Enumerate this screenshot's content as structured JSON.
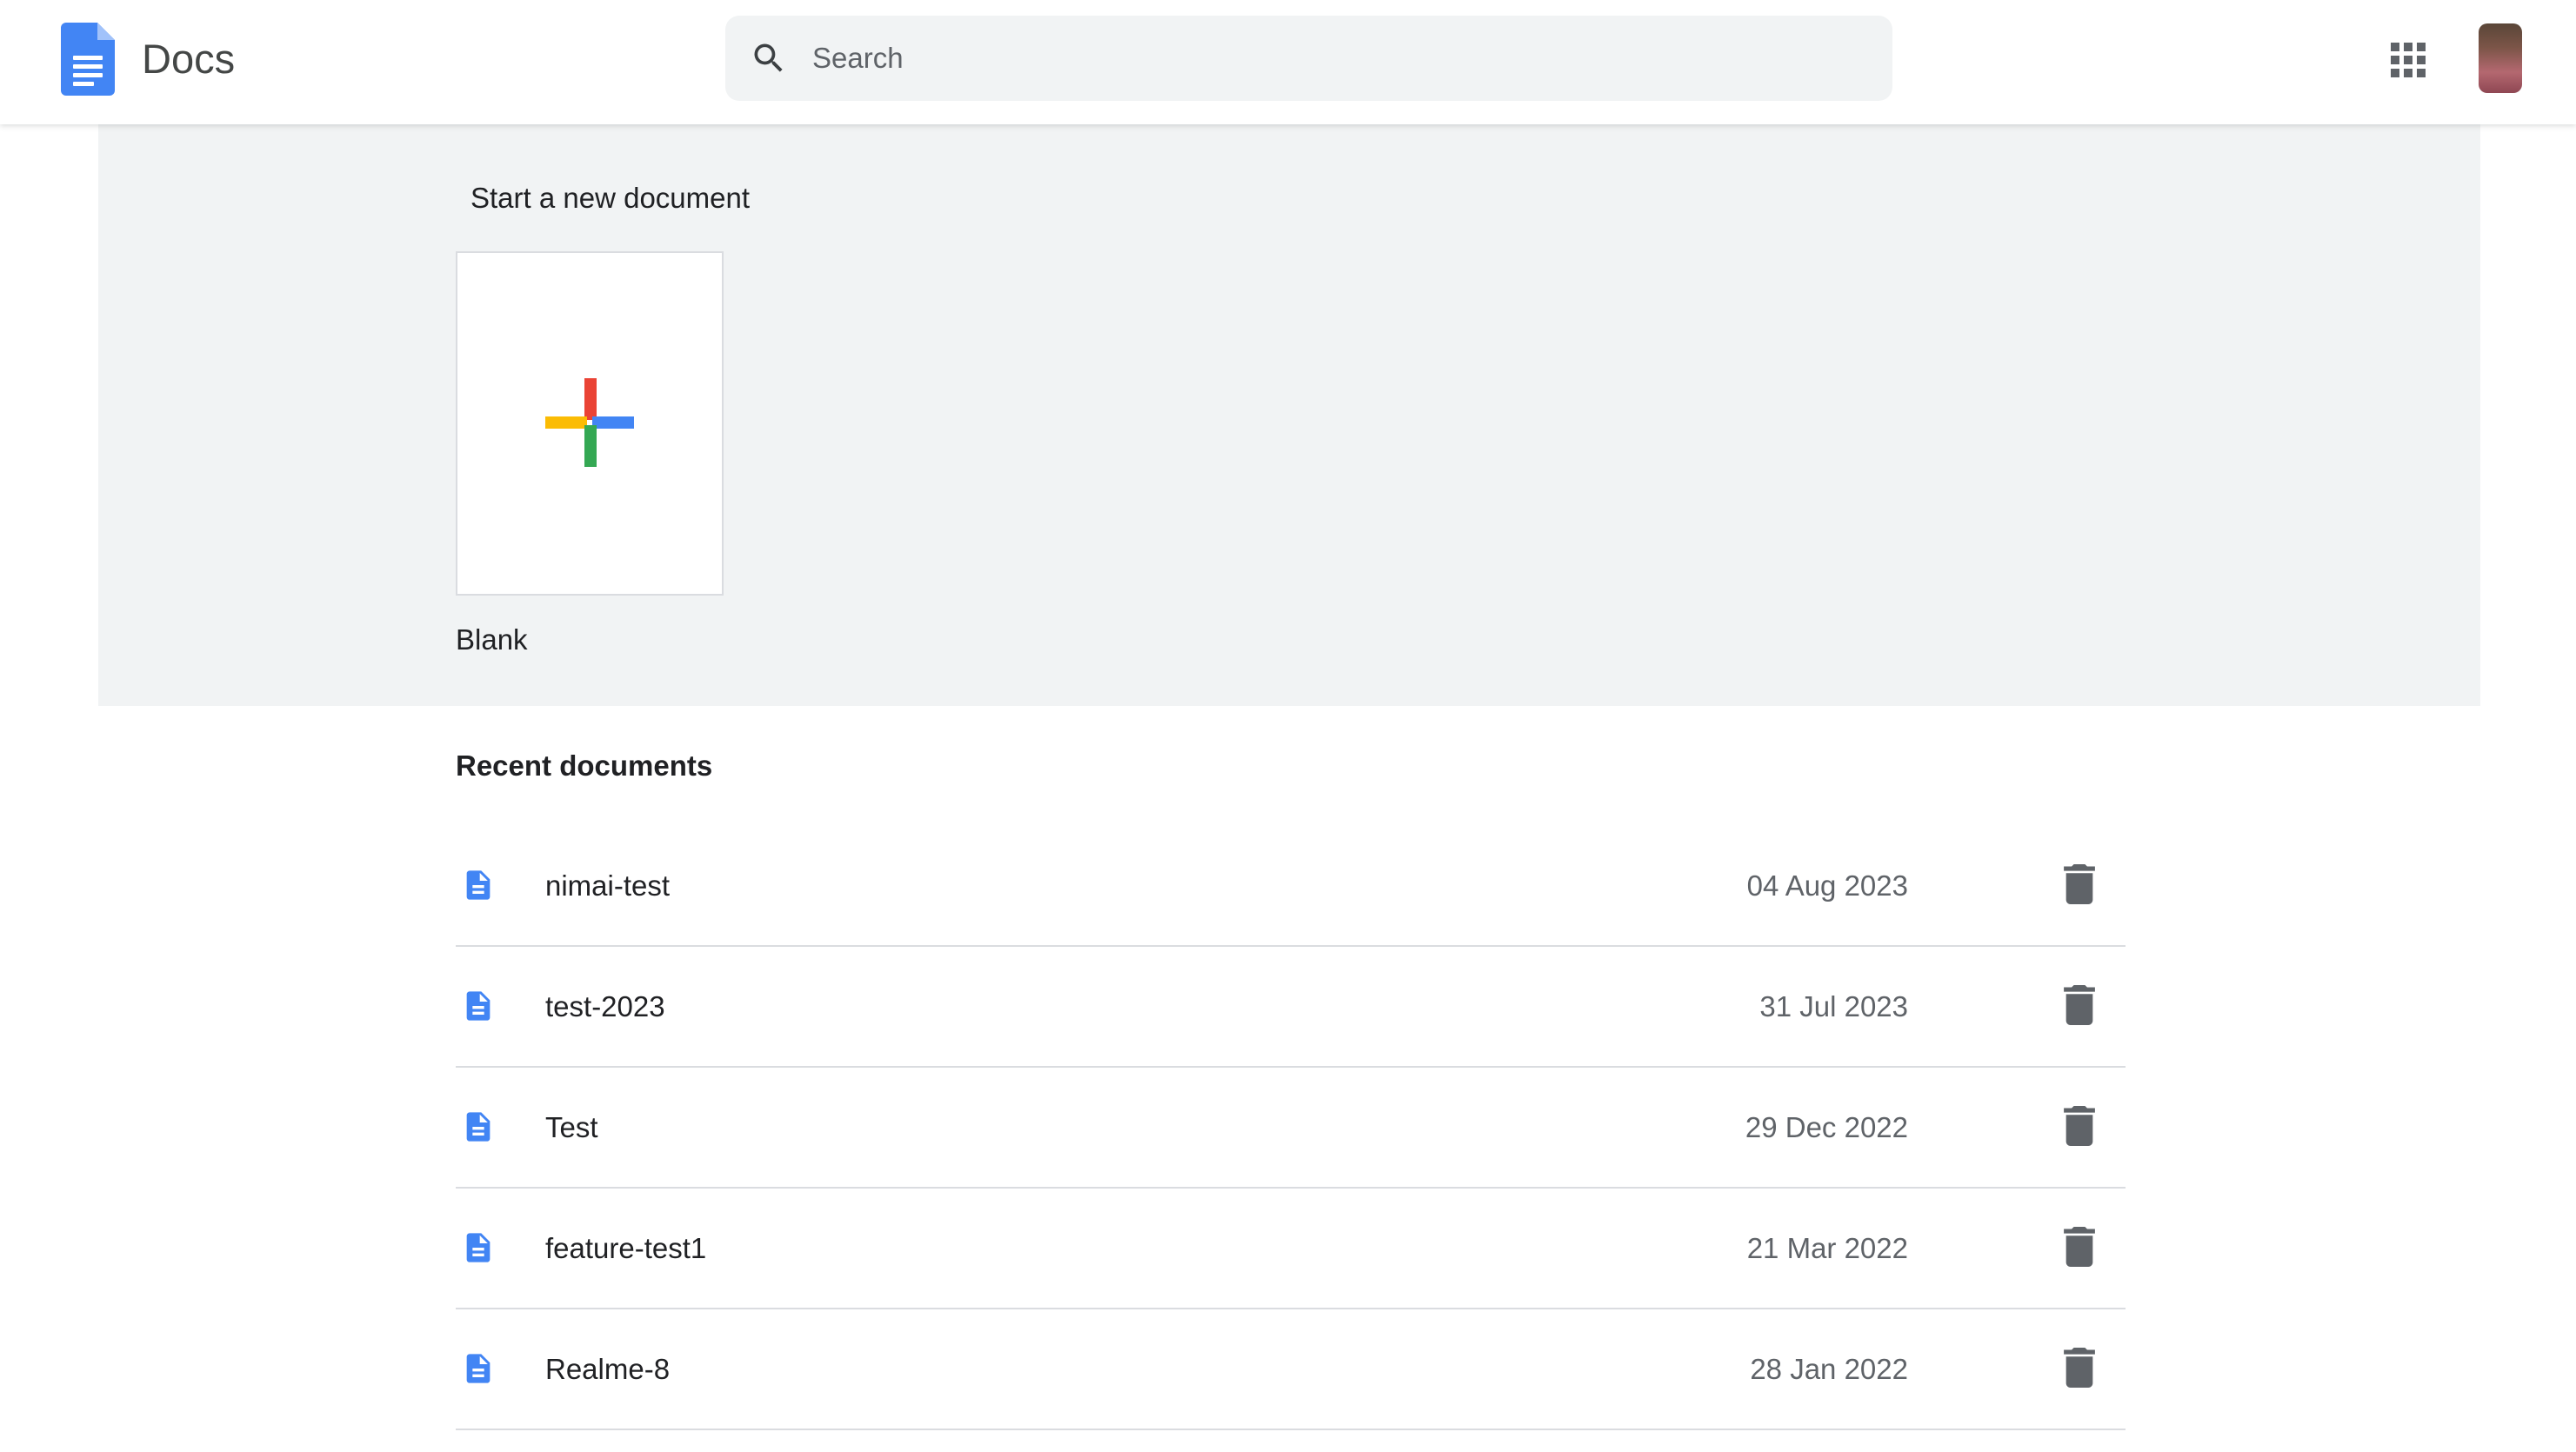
{
  "header": {
    "app_title": "Docs",
    "search_placeholder": "Search",
    "search_value": "",
    "apps_icon": "apps-grid-icon",
    "avatar": "user-avatar"
  },
  "new_document": {
    "heading": "Start a new document",
    "templates": [
      {
        "label": "Blank",
        "icon": "multicolor-plus-icon"
      }
    ]
  },
  "recent": {
    "heading": "Recent documents",
    "documents": [
      {
        "name": "nimai-test",
        "date": "04 Aug 2023"
      },
      {
        "name": "test-2023",
        "date": "31 Jul 2023"
      },
      {
        "name": "Test",
        "date": "29 Dec 2022"
      },
      {
        "name": "feature-test1",
        "date": "21 Mar 2022"
      },
      {
        "name": "Realme-8",
        "date": "28 Jan 2022"
      }
    ]
  },
  "colors": {
    "brand_blue": "#4285f4",
    "plus_red": "#ea4335",
    "plus_yellow": "#fbbc04",
    "plus_green": "#34a853",
    "section_bg": "#f1f3f4",
    "icon_dark": "#5f6368"
  }
}
